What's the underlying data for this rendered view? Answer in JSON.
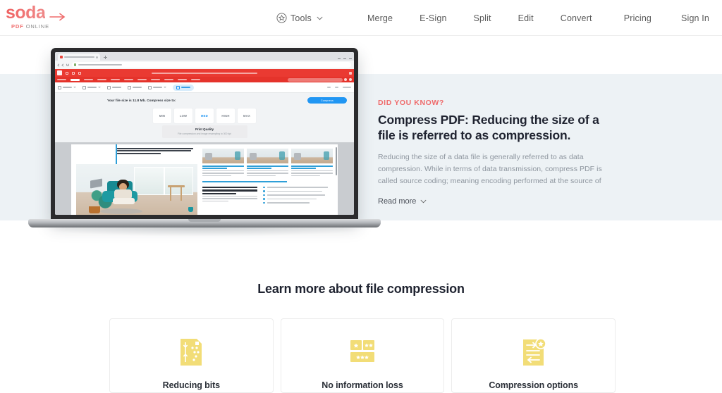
{
  "brand": {
    "name": "soda",
    "sub_pdf": "PDF",
    "sub_online": "ONLINE",
    "logo_arrow_icon": "arrow-right-icon",
    "accent_color": "#ef6b6b"
  },
  "header": {
    "tools": {
      "label": "Tools",
      "icon": "star-circle-icon",
      "chevron": "chevron-down-icon"
    },
    "links": [
      {
        "label": "Merge"
      },
      {
        "label": "E-Sign"
      },
      {
        "label": "Split"
      },
      {
        "label": "Edit"
      },
      {
        "label": "Convert"
      }
    ],
    "right": [
      {
        "label": "Pricing"
      },
      {
        "label": "Sign In"
      }
    ]
  },
  "hero": {
    "kicker": "DID YOU KNOW?",
    "title": "Compress PDF: Reducing the size of a file is referred to as compression.",
    "body": "Reducing the size of a data file is generally referred to as data compression. While in terms of data transmission, compress PDF is called source coding; meaning encoding performed at the source of",
    "read_more": "Read more",
    "read_more_chevron": "chevron-down-icon",
    "background_color": "#edf2f5"
  },
  "app_preview": {
    "compress_note": "Your file size is 11.8 Mb. Compress size to:",
    "compress_button": "Compress",
    "quality_options": [
      {
        "label": "MIN",
        "selected": false
      },
      {
        "label": "LOW",
        "selected": false
      },
      {
        "label": "MED",
        "selected": true
      },
      {
        "label": "HIGH",
        "selected": false
      },
      {
        "label": "MAX",
        "selected": false
      }
    ],
    "quality_caption_title": "Print Quality",
    "quality_caption_sub": "File compression and image resampling to 300 dpi",
    "ribbon_color": "#ea3a32",
    "selected_color": "#2196f3"
  },
  "learn_more": {
    "title": "Learn more about file compression",
    "cards": [
      {
        "title": "Reducing bits",
        "icon": "document-bits-icon"
      },
      {
        "title": "No information loss",
        "icon": "blocks-dots-icon"
      },
      {
        "title": "Compression options",
        "icon": "document-arrows-star-icon"
      }
    ],
    "icon_color": "#f2dd77"
  }
}
